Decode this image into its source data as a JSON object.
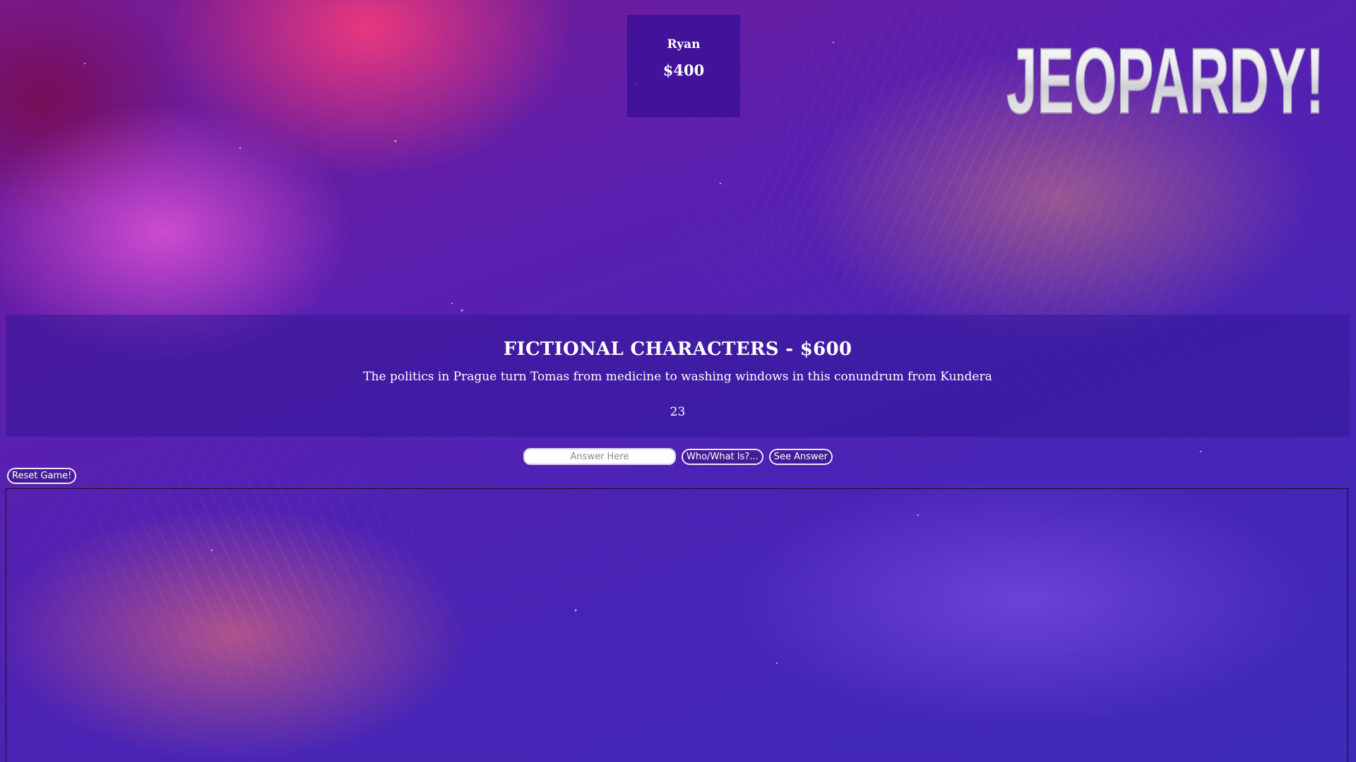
{
  "player": {
    "name": "Ryan",
    "score": "$400"
  },
  "logo": {
    "text": "JEOPARDY!"
  },
  "question": {
    "title": "FICTIONAL CHARACTERS - $600",
    "text": "The politics in Prague turn Tomas from medicine to washing windows in this conundrum from Kundera",
    "timer": "23"
  },
  "answer": {
    "placeholder": "Answer Here",
    "submit_label": "Who/What Is?...",
    "reveal_label": "See Answer"
  },
  "controls": {
    "reset_label": "Reset Game!"
  },
  "colors": {
    "panel": "#30169a",
    "player_card": "#340e96",
    "text": "#ffffff"
  }
}
